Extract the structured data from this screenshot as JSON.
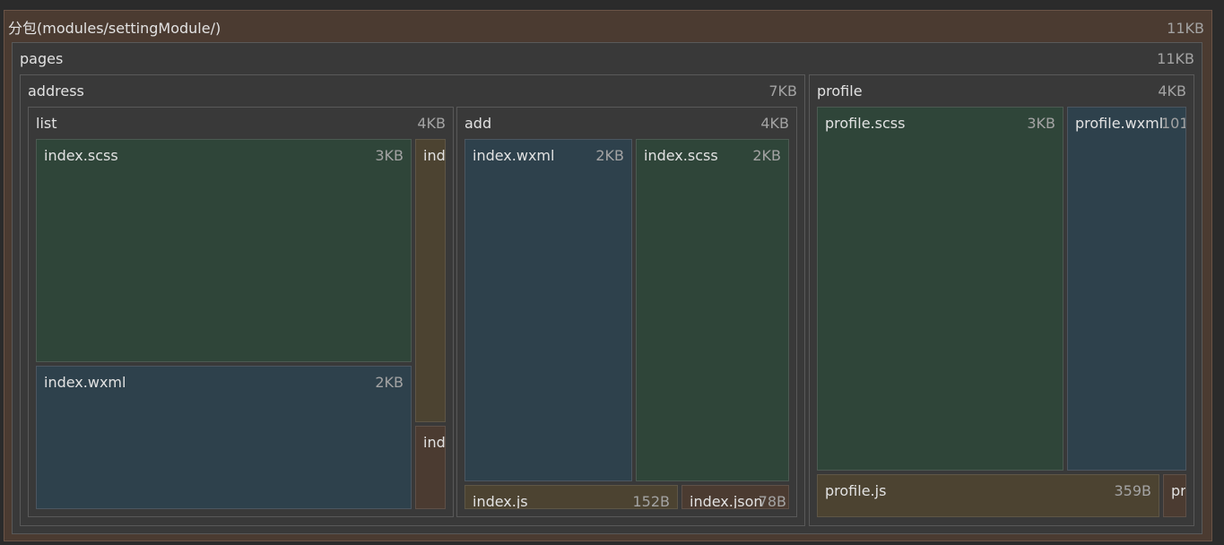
{
  "treemap": {
    "root": {
      "label": "分包(modules/settingModule/)",
      "size": "11KB"
    },
    "pages": {
      "label": "pages",
      "size": "11KB"
    },
    "address": {
      "label": "address",
      "size": "7KB"
    },
    "list": {
      "label": "list",
      "size": "4KB"
    },
    "list_index_scss": {
      "label": "index.scss",
      "size": "3KB"
    },
    "list_index_wxml": {
      "label": "index.wxml",
      "size": "2KB"
    },
    "list_index_js": {
      "label": "ind",
      "size": ""
    },
    "list_index_json": {
      "label": "ind",
      "size": ""
    },
    "add": {
      "label": "add",
      "size": "4KB"
    },
    "add_index_wxml": {
      "label": "index.wxml",
      "size": "2KB"
    },
    "add_index_scss": {
      "label": "index.scss",
      "size": "2KB"
    },
    "add_index_js": {
      "label": "index.js",
      "size": "152B"
    },
    "add_index_json": {
      "label": "index.json",
      "size": "78B"
    },
    "profile": {
      "label": "profile",
      "size": "4KB"
    },
    "profile_scss": {
      "label": "profile.scss",
      "size": "3KB"
    },
    "profile_wxml": {
      "label": "profile.wxml",
      "size": "101"
    },
    "profile_js": {
      "label": "profile.js",
      "size": "359B"
    },
    "profile_json": {
      "label": "pr",
      "size": ""
    }
  }
}
